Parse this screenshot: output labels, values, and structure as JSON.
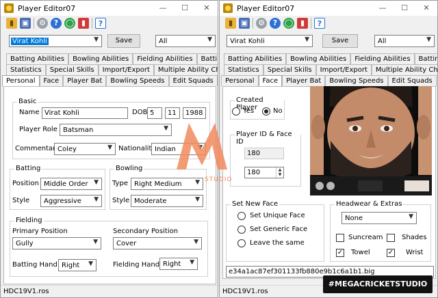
{
  "left": {
    "title": "Player Editor07",
    "player_combo": "Virat Kohli",
    "save_label": "Save",
    "filter_combo": "All",
    "tabs_row1": [
      "Batting Abilities",
      "Bowling Abilities",
      "Fielding Abilities",
      "Batting Skills"
    ],
    "tabs_row2": [
      "Statistics",
      "Special Skills",
      "Import/Export",
      "Multiple Ability Changer"
    ],
    "tabs_row3": [
      "Personal",
      "Face",
      "Player Bat",
      "Bowling Speeds",
      "Edit Squads"
    ],
    "basic": {
      "title": "Basic",
      "name_label": "Name",
      "name_value": "Virat Kohli",
      "dob_label": "DOB",
      "dob_day": "5",
      "dob_month": "11",
      "dob_year": "1988",
      "role_label": "Player Role",
      "role_value": "Batsman",
      "commentary_label": "Commentary",
      "commentary_value": "Coley",
      "nationality_label": "Nationality",
      "nationality_value": "Indian"
    },
    "batting": {
      "title": "Batting",
      "position_label": "Position",
      "position_value": "Middle Order",
      "style_label": "Style",
      "style_value": "Aggressive"
    },
    "bowling": {
      "title": "Bowling",
      "type_label": "Type",
      "type_value": "Right Medium",
      "style_label": "Style",
      "style_value": "Moderate"
    },
    "fielding": {
      "title": "Fielding",
      "primary_label": "Primary Position",
      "primary_value": "Gully",
      "secondary_label": "Secondary Position",
      "secondary_value": "Cover",
      "bat_hand_label": "Batting Hand",
      "bat_hand_value": "Right",
      "field_hand_label": "Fielding Hand",
      "field_hand_value": "Right"
    },
    "status": "HDC19V1.ros"
  },
  "right": {
    "title": "Player Editor07",
    "player_combo": "Virat Kohli",
    "save_label": "Save",
    "filter_combo": "All",
    "tabs_row1": [
      "Batting Abilities",
      "Bowling Abilities",
      "Fielding Abilities",
      "Batting Skills"
    ],
    "tabs_row2": [
      "Statistics",
      "Special Skills",
      "Import/Export",
      "Multiple Ability Changer"
    ],
    "tabs_row3": [
      "Personal",
      "Face",
      "Player Bat",
      "Bowling Speeds",
      "Edit Squads"
    ],
    "created": {
      "title": "Created Player",
      "yes": "Yes",
      "no": "No"
    },
    "ids": {
      "title": "Player ID & Face ID",
      "player_id": "180",
      "face_id": "180"
    },
    "new_face": {
      "title": "Set New Face",
      "unique": "Set Unique Face",
      "generic": "Set Generic Face",
      "leave": "Leave the same"
    },
    "headwear": {
      "title": "Headwear & Extras",
      "value": "None",
      "suncream": "Suncream",
      "shades": "Shades",
      "towel": "Towel",
      "wrist": "Wrist"
    },
    "hash": "e34a1ac87ef301133fb880e9b1c6a1b1.big",
    "status": "HDC19V1.ros"
  },
  "watermark": {
    "studio": "STUDIO",
    "badge": "#MEGACRICKETSTUDIO"
  },
  "colors": {
    "accent": "#0078d7",
    "watermark": "#f08a5d"
  }
}
